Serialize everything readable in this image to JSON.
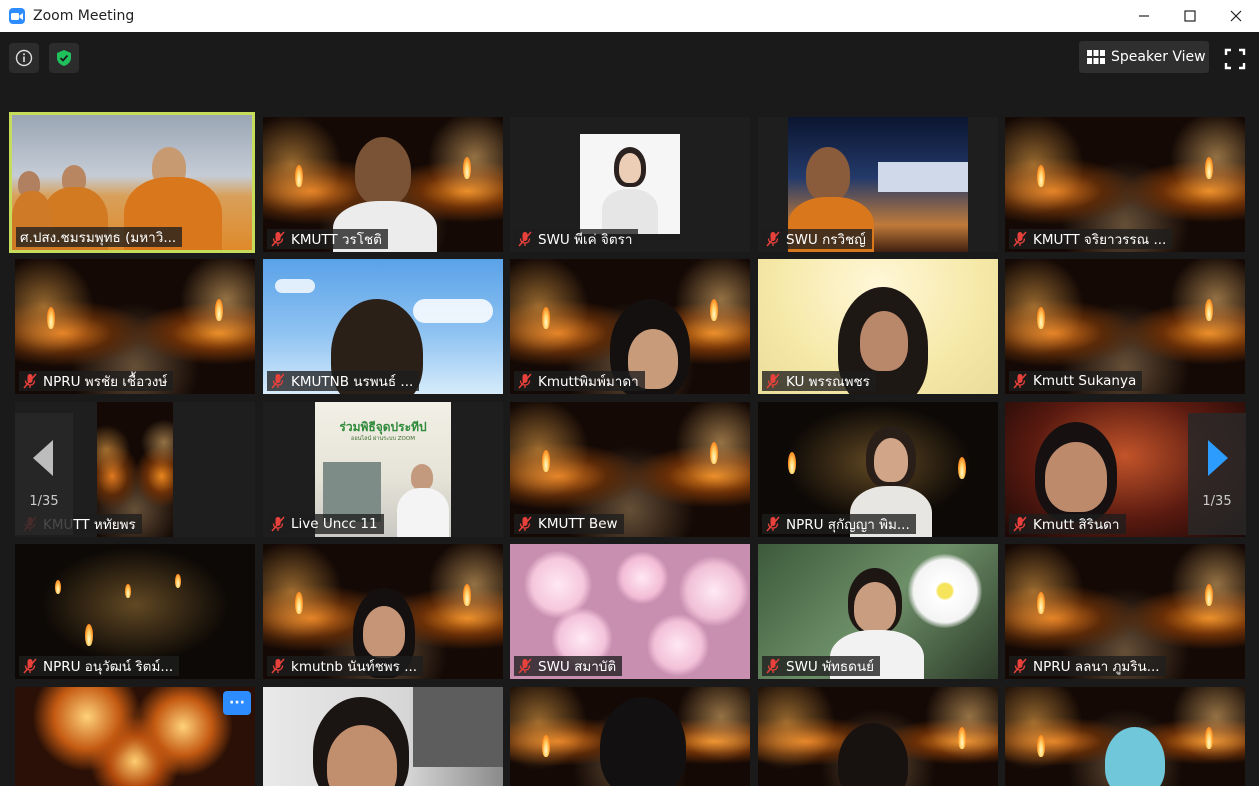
{
  "window": {
    "title": "Zoom Meeting",
    "minimize_glyph": "—",
    "maximize_glyph": "☐",
    "close_glyph": "✕"
  },
  "toolbar": {
    "info_icon": "info-icon",
    "security_icon": "shield-check-icon",
    "speaker_view_label": "Speaker View",
    "fullscreen_icon": "fullscreen-icon"
  },
  "colors": {
    "active_speaker_border": "#c6dc5b",
    "mute_icon": "#e8413b",
    "zoom_blue": "#2d8cff",
    "security_green": "#20c05c"
  },
  "pagination": {
    "left_label": "1/35",
    "right_label": "1/35"
  },
  "participants": [
    {
      "name": "ศ.ปสง.ชมรมพุทธ (มหาวิ...",
      "muted": false,
      "active": true
    },
    {
      "name": "KMUTT วรโชติ",
      "muted": true
    },
    {
      "name": "SWU พีเค่ จิตรา",
      "muted": true
    },
    {
      "name": "SWU กรวิชญ์",
      "muted": true
    },
    {
      "name": "KMUTT จริยาวรรณ ...",
      "muted": true
    },
    {
      "name": "NPRU พรชัย เชื้อวงษ์",
      "muted": true
    },
    {
      "name": "KMUTNB นรพนธ์ ...",
      "muted": true
    },
    {
      "name": "Kmuttพิมพ์มาดา",
      "muted": true
    },
    {
      "name": "KU พรรณพชร",
      "muted": true
    },
    {
      "name": "Kmutt Sukanya",
      "muted": true
    },
    {
      "name": "KMUTT หทัยพร",
      "muted": true
    },
    {
      "name": "Live Uncc 11",
      "muted": true
    },
    {
      "name": "KMUTT Bew",
      "muted": true
    },
    {
      "name": "NPRU สุกัญญา พิม...",
      "muted": true
    },
    {
      "name": "Kmutt สิรินดา",
      "muted": true
    },
    {
      "name": "NPRU อนุวัฒน์ ริตม์...",
      "muted": true
    },
    {
      "name": "kmutnb นันท์ชพร ...",
      "muted": true
    },
    {
      "name": "SWU สมาบัติ",
      "muted": true
    },
    {
      "name": "SWU พัทธดนย์",
      "muted": true
    },
    {
      "name": "NPRU ลลนา ภูมริน...",
      "muted": true
    }
  ],
  "poster_text": {
    "line1": "ร่วมพิธีจุดประทีป",
    "line2": "ออนไลน์ ผ่านระบบ ZOOM"
  },
  "more_button_label": "···"
}
